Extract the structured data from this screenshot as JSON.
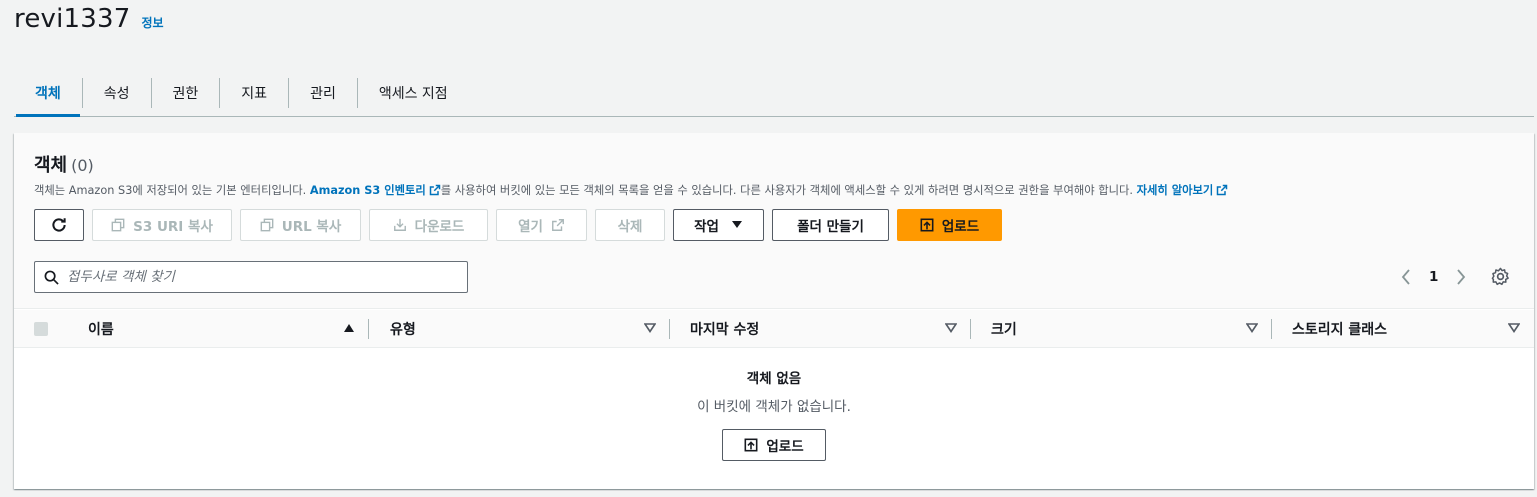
{
  "header": {
    "bucket_name": "revi1337",
    "info_link": "정보"
  },
  "tabs": [
    {
      "label": "객체",
      "active": true
    },
    {
      "label": "속성"
    },
    {
      "label": "권한"
    },
    {
      "label": "지표"
    },
    {
      "label": "관리"
    },
    {
      "label": "액세스 지점"
    }
  ],
  "objects_panel": {
    "title": "객체",
    "count": "(0)",
    "description_pre": "객체는 Amazon S3에 저장되어 있는 기본 엔터티입니다. ",
    "inventory_link": "Amazon S3 인벤토리",
    "description_mid": "를 사용하여 버킷에 있는 모든 객체의 목록을 얻을 수 있습니다. 다른 사용자가 객체에 액세스할 수 있게 하려면 명시적으로 권한을 부여해야 합니다. ",
    "learn_more_link": "자세히 알아보기"
  },
  "toolbar": {
    "copy_s3_uri": "S3 URI 복사",
    "copy_url": "URL 복사",
    "download": "다운로드",
    "open": "열기",
    "delete": "삭제",
    "actions": "작업",
    "create_folder": "폴더 만들기",
    "upload": "업로드"
  },
  "search": {
    "placeholder": "접두사로 객체 찾기",
    "value": ""
  },
  "pagination": {
    "current_page": "1"
  },
  "table": {
    "columns": [
      "이름",
      "유형",
      "마지막 수정",
      "크기",
      "스토리지 클래스"
    ]
  },
  "empty_state": {
    "title": "객체 없음",
    "description": "이 버킷에 객체가 없습니다.",
    "upload_button": "업로드"
  },
  "colors": {
    "accent": "#0073bb",
    "primary_button": "#ff9900",
    "text": "#16191f",
    "secondary_text": "#545b64"
  }
}
